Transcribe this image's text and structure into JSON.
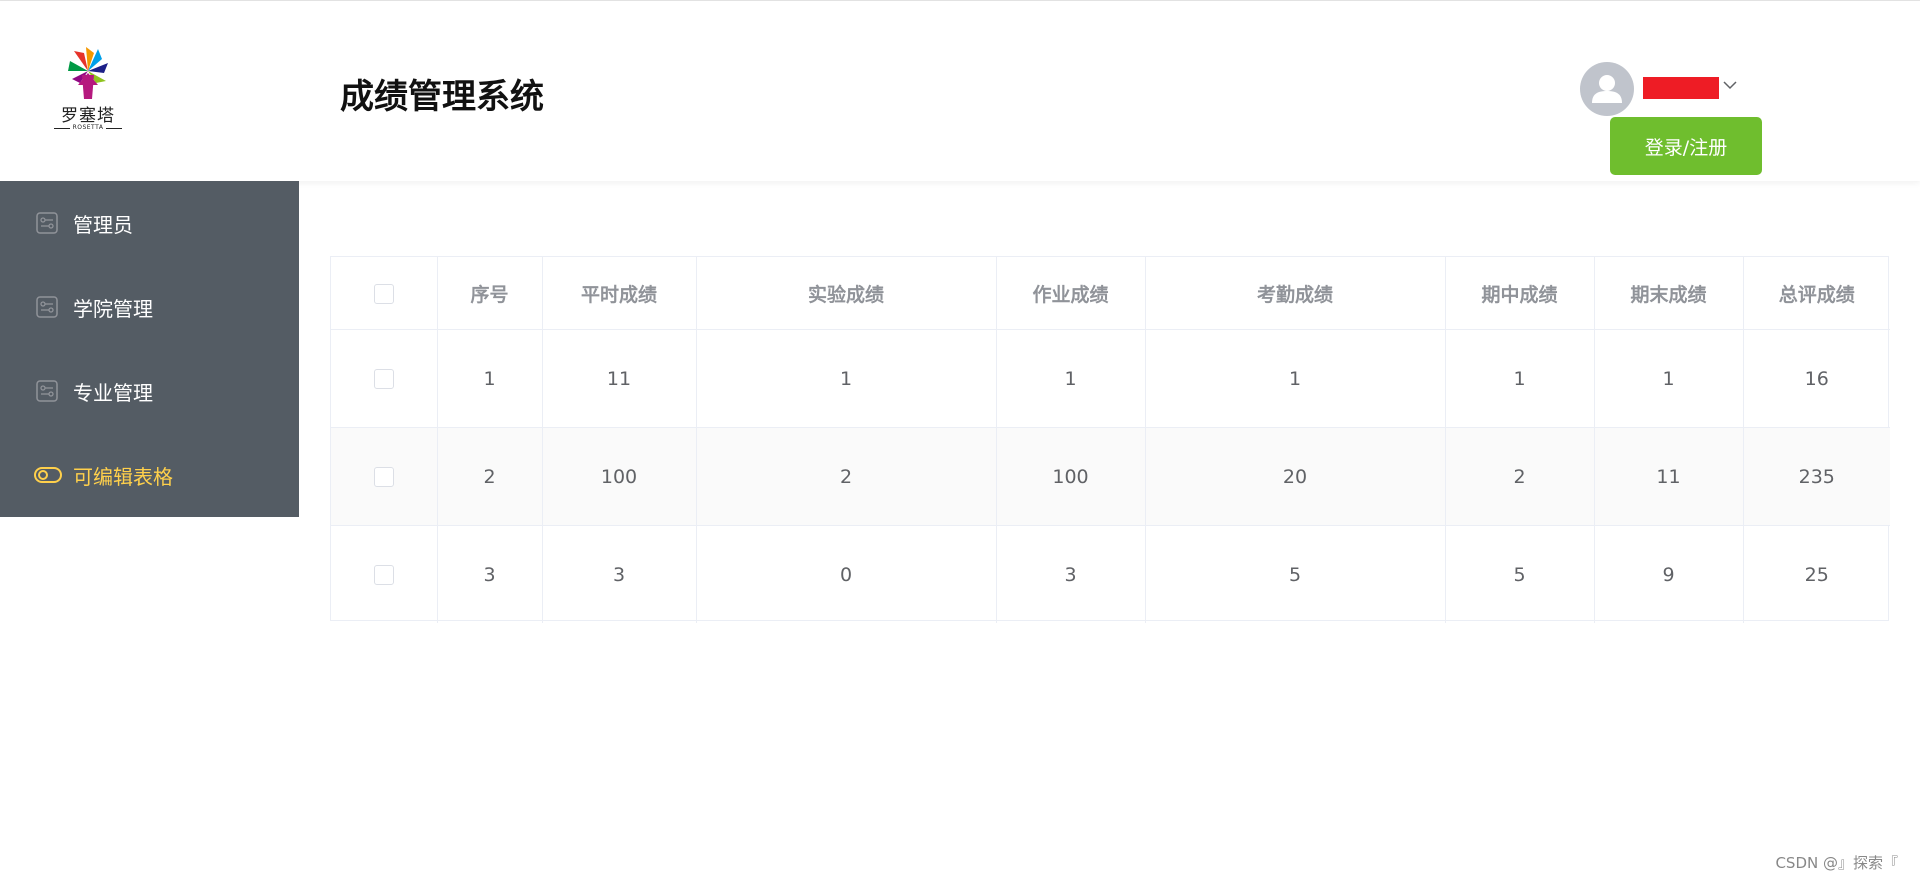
{
  "header": {
    "logo_text": "罗塞塔",
    "logo_sub": "ROSETTA",
    "app_title": "成绩管理系统",
    "login_button": "登录/注册"
  },
  "sidebar": {
    "items": [
      {
        "label": "管理员",
        "active": false
      },
      {
        "label": "学院管理",
        "active": false
      },
      {
        "label": "专业管理",
        "active": false
      },
      {
        "label": "可编辑表格",
        "active": true
      }
    ]
  },
  "table": {
    "columns": [
      "序号",
      "平时成绩",
      "实验成绩",
      "作业成绩",
      "考勤成绩",
      "期中成绩",
      "期末成绩",
      "总评成绩"
    ],
    "rows": [
      [
        "1",
        "11",
        "1",
        "1",
        "1",
        "1",
        "1",
        "16"
      ],
      [
        "2",
        "100",
        "2",
        "100",
        "20",
        "2",
        "11",
        "235"
      ],
      [
        "3",
        "3",
        "0",
        "3",
        "5",
        "5",
        "9",
        "25"
      ]
    ]
  },
  "watermark": "CSDN @』探索『",
  "colors": {
    "sidebar_bg": "#545c64",
    "active_menu": "#ffd04b",
    "login_button": "#6fbe2e",
    "username_redaction": "#ee1c25"
  }
}
